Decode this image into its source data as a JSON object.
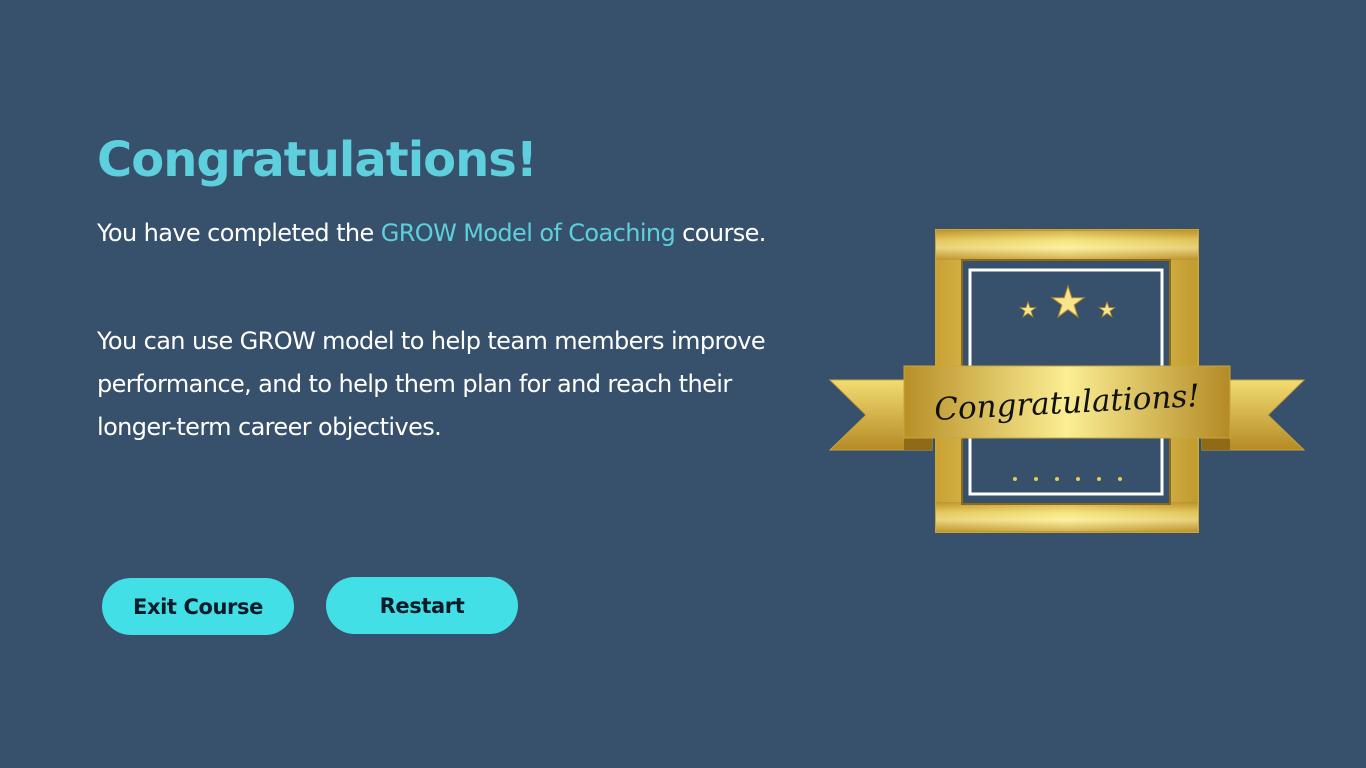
{
  "heading": "Congratulations!",
  "completion": {
    "prefix": "You have completed the ",
    "course_name": "GROW Model of Coaching",
    "suffix": " course."
  },
  "description": "You can use GROW model to help team members improve performance, and to help them plan for and reach their longer-term career objectives.",
  "buttons": {
    "exit_label": "Exit Course",
    "restart_label": "Restart"
  },
  "badge": {
    "ribbon_text": "Congratulations!",
    "icon": "certificate-badge-icon"
  },
  "colors": {
    "background": "#37506b",
    "accent": "#5ecfdc",
    "button": "#42dfe6",
    "gold": "#d4b443"
  }
}
